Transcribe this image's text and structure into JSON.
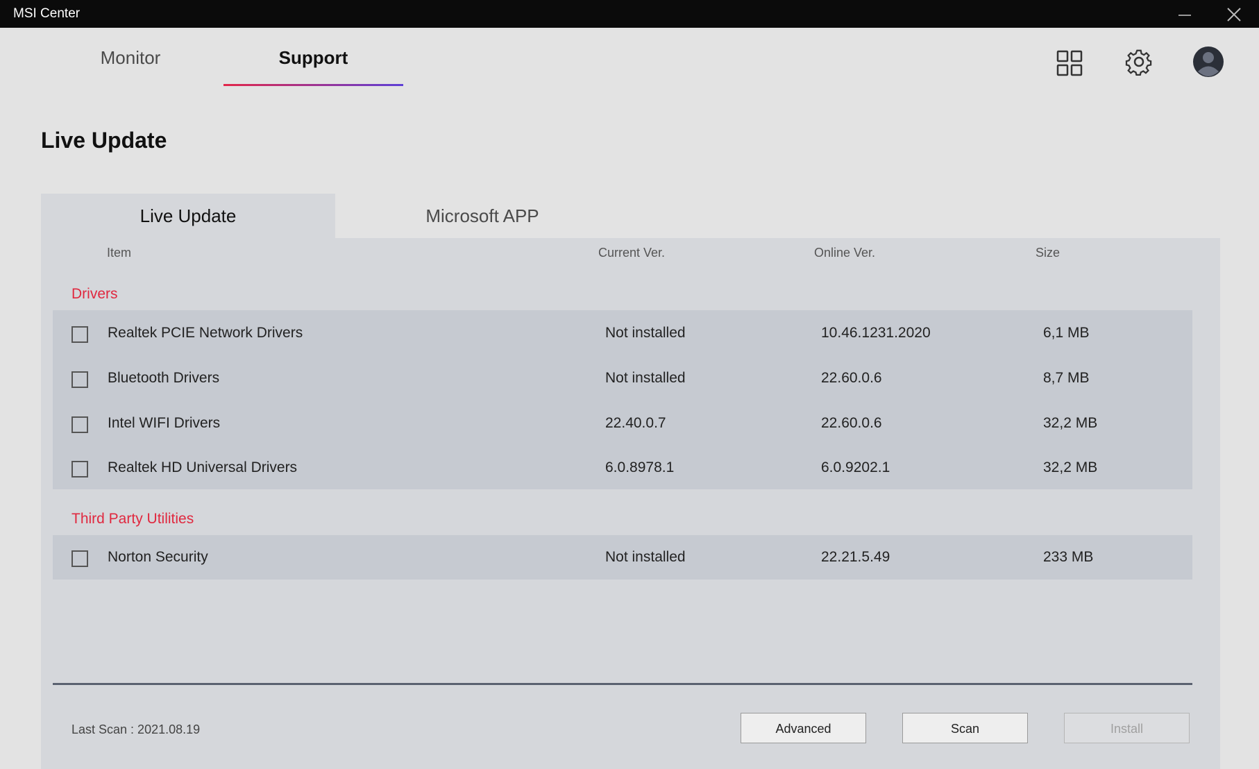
{
  "window": {
    "title": "MSI Center",
    "minimize_icon": "minimize-icon",
    "close_icon": "close-icon"
  },
  "nav": {
    "tabs": [
      {
        "label": "Monitor",
        "active": false
      },
      {
        "label": "Support",
        "active": true
      }
    ],
    "icons": [
      "grid-icon",
      "gear-icon",
      "avatar-icon"
    ],
    "accent_gradient": [
      "#e3274a",
      "#5d3fd6"
    ]
  },
  "page": {
    "title": "Live Update"
  },
  "panel_tabs": [
    {
      "label": "Live Update",
      "active": true
    },
    {
      "label": "Microsoft APP",
      "active": false
    }
  ],
  "table": {
    "columns": {
      "item": "Item",
      "current": "Current Ver.",
      "online": "Online Ver.",
      "size": "Size"
    },
    "groups": [
      {
        "label": "Drivers",
        "rows": [
          {
            "item": "Realtek PCIE Network Drivers",
            "current": "Not installed",
            "online": "10.46.1231.2020",
            "size": "6,1 MB",
            "checked": false
          },
          {
            "item": "Bluetooth Drivers",
            "current": "Not installed",
            "online": "22.60.0.6",
            "size": "8,7 MB",
            "checked": false
          },
          {
            "item": "Intel WIFI Drivers",
            "current": "22.40.0.7",
            "online": "22.60.0.6",
            "size": "32,2 MB",
            "checked": false
          },
          {
            "item": "Realtek HD Universal Drivers",
            "current": "6.0.8978.1",
            "online": "6.0.9202.1",
            "size": "32,2 MB",
            "checked": false
          }
        ]
      },
      {
        "label": "Third Party Utilities",
        "rows": [
          {
            "item": "Norton Security",
            "current": "Not installed",
            "online": "22.21.5.49",
            "size": "233 MB",
            "checked": false
          }
        ]
      }
    ],
    "group_label_color": "#e0283f"
  },
  "footer": {
    "last_scan": "Last Scan : 2021.08.19",
    "buttons": {
      "advanced": "Advanced",
      "scan": "Scan",
      "install": "Install"
    },
    "install_disabled": true
  }
}
